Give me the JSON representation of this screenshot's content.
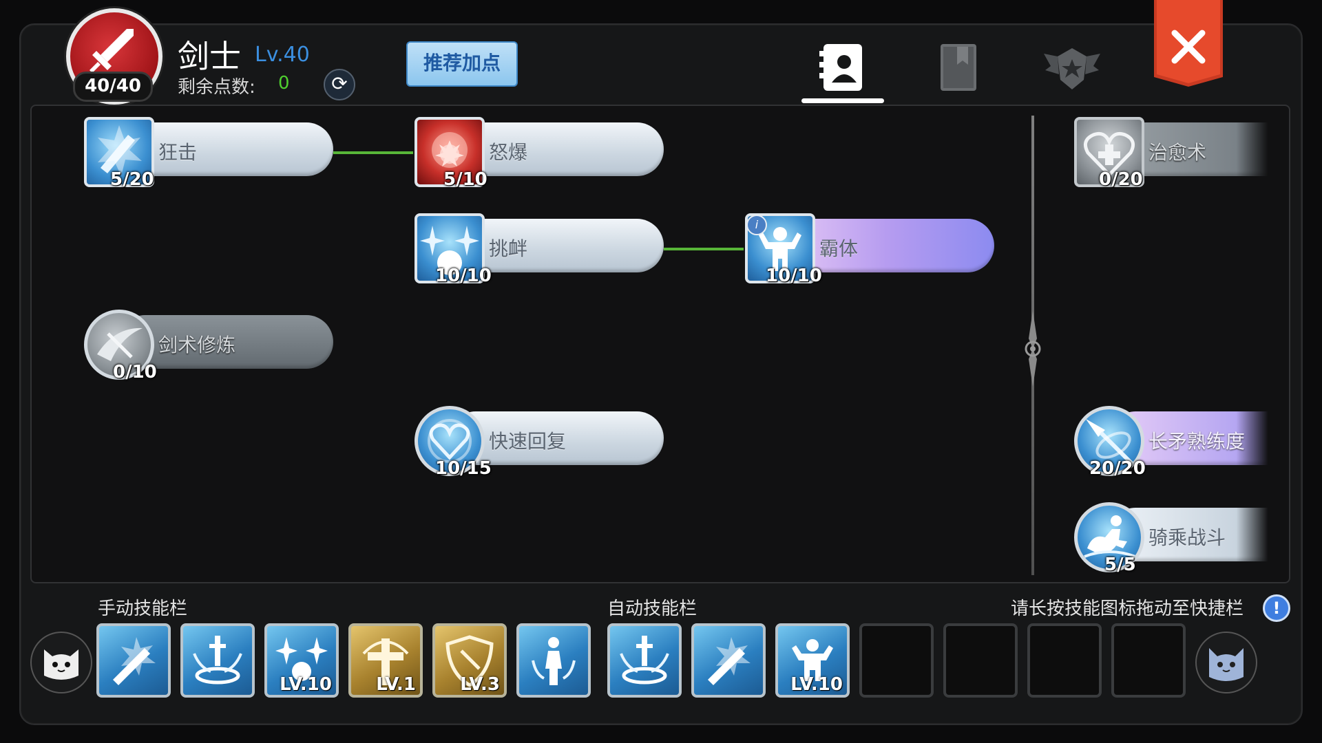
{
  "header": {
    "class_name": "剑士",
    "class_level": "Lv.40",
    "class_points": "40/40",
    "remaining_points_label": "剩余点数:",
    "remaining_points_value": "0",
    "recommend_button": "推荐加点",
    "tabs": [
      {
        "icon": "skill-profile-icon",
        "active": true
      },
      {
        "icon": "bookmark-book-icon",
        "active": false
      },
      {
        "icon": "winged-emblem-icon",
        "active": false
      }
    ]
  },
  "skills": {
    "kuangji": {
      "name": "狂击",
      "level": "5/20"
    },
    "nubao": {
      "name": "怒爆",
      "level": "5/10"
    },
    "tiaoxin": {
      "name": "挑衅",
      "level": "10/10"
    },
    "bati": {
      "name": "霸体",
      "level": "10/10"
    },
    "jianshu": {
      "name": "剑术修炼",
      "level": "0/10"
    },
    "kuaisu": {
      "name": "快速回复",
      "level": "10/15"
    },
    "zhiyu": {
      "name": "治愈术",
      "level": "0/20"
    },
    "changmao": {
      "name": "长矛熟练度",
      "level": "20/20"
    },
    "qicheng": {
      "name": "骑乘战斗",
      "level": "5/5"
    }
  },
  "bottom": {
    "manual_label": "手动技能栏",
    "auto_label": "自动技能栏",
    "hint": "请长按技能图标拖动至快捷栏",
    "manual_slots": [
      {
        "icon": "sword-strike-icon",
        "level": ""
      },
      {
        "icon": "sword-burst-icon",
        "level": ""
      },
      {
        "icon": "taunt-stars-icon",
        "level": "LV.10"
      },
      {
        "icon": "holy-cross-icon",
        "level": "LV.1"
      },
      {
        "icon": "shield-icon",
        "level": "LV.3"
      },
      {
        "icon": "person-recover-icon",
        "level": ""
      }
    ],
    "auto_slots": [
      {
        "icon": "sword-burst-icon",
        "level": ""
      },
      {
        "icon": "sword-strike-icon",
        "level": ""
      },
      {
        "icon": "super-armor-icon",
        "level": "LV.10"
      }
    ]
  }
}
